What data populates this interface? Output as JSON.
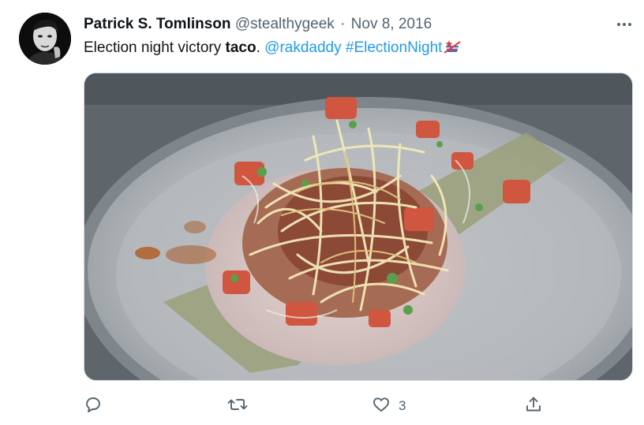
{
  "author": {
    "name": "Patrick S. Tomlinson",
    "handle": "@stealthygeek",
    "separator": "·",
    "date": "Nov 8, 2016"
  },
  "tweet": {
    "text_before": "Election night victory ",
    "text_bold": "taco",
    "text_after": ". ",
    "mention": "@rakdaddy",
    "space": " ",
    "hashtag": "#ElectionNight",
    "emoji_icon": "election-ballot-emoji-icon"
  },
  "actions": {
    "reply_icon": "reply-icon",
    "retweet_icon": "retweet-icon",
    "like_icon": "heart-icon",
    "like_count": "3",
    "share_icon": "share-icon"
  },
  "colors": {
    "link": "#1d9bf0",
    "secondary_text": "#536471",
    "primary_text": "#0f1419"
  }
}
